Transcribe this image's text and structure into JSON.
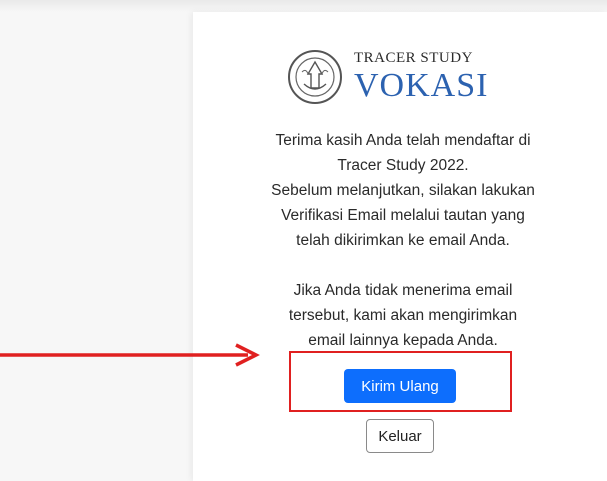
{
  "logo": {
    "line1": "TRACER STUDY",
    "line2": "VOKASI",
    "emblem_icon": "tut-wuri-handayani-emblem-icon",
    "brand_color": "#2c62b0"
  },
  "message": {
    "lines": [
      "Terima kasih Anda telah mendaftar di",
      "Tracer Study 2022.",
      "Sebelum melanjutkan, silakan lakukan",
      "Verifikasi Email melalui tautan yang",
      "telah dikirimkan ke email Anda."
    ],
    "lines2": [
      "Jika Anda tidak menerima email",
      "tersebut, kami akan mengirimkan",
      "email lainnya kepada Anda."
    ]
  },
  "buttons": {
    "resend_label": "Kirim Ulang",
    "logout_label": "Keluar",
    "primary_color": "#0d6efd"
  },
  "annotation": {
    "highlight_color": "#e02020",
    "arrow_icon": "arrow-right-icon"
  }
}
